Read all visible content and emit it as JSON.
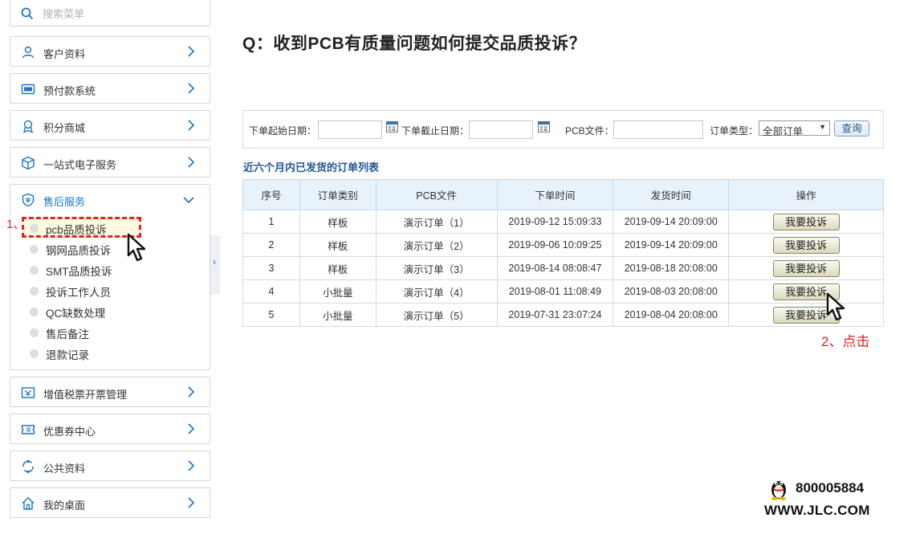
{
  "sidebar": {
    "search_placeholder": "搜索菜单",
    "items": [
      {
        "label": "客户资料"
      },
      {
        "label": "预付款系统"
      },
      {
        "label": "积分商城"
      },
      {
        "label": "一站式电子服务"
      }
    ],
    "expanded": {
      "label": "售后服务",
      "sub_items": [
        {
          "label": "pcb品质投诉"
        },
        {
          "label": "钢网品质投诉"
        },
        {
          "label": "SMT品质投诉"
        },
        {
          "label": "投诉工作人员"
        },
        {
          "label": "QC缺数处理"
        },
        {
          "label": "售后备注"
        },
        {
          "label": "退款记录"
        }
      ]
    },
    "items_after": [
      {
        "label": "增值税票开票管理"
      },
      {
        "label": "优惠券中心"
      },
      {
        "label": "公共资料"
      },
      {
        "label": "我的桌面"
      }
    ],
    "annotation": "1、"
  },
  "main": {
    "title": "Q：收到PCB有质量问题如何提交品质投诉？",
    "filter": {
      "start_date_label": "下单起始日期：",
      "end_date_label": "下单截止日期：",
      "pcb_file_label": "PCB文件：",
      "order_type_label": "订单类型：",
      "order_type_value": "全部订单",
      "query_button": "查询"
    },
    "list_title": "近六个月内已发货的订单列表",
    "table": {
      "headers": [
        "序号",
        "订单类别",
        "PCB文件",
        "下单时间",
        "发货时间",
        "操作"
      ],
      "rows": [
        {
          "no": "1",
          "type": "样板",
          "file": "演示订单（1）",
          "order_time": "2019-09-12 15:09:33",
          "ship_time": "2019-09-14 20:09:00",
          "action": "我要投诉"
        },
        {
          "no": "2",
          "type": "样板",
          "file": "演示订单（2）",
          "order_time": "2019-09-06 10:09:25",
          "ship_time": "2019-09-14 20:09:00",
          "action": "我要投诉"
        },
        {
          "no": "3",
          "type": "样板",
          "file": "演示订单（3）",
          "order_time": "2019-08-14 08:08:47",
          "ship_time": "2019-08-18 20:08:00",
          "action": "我要投诉"
        },
        {
          "no": "4",
          "type": "小批量",
          "file": "演示订单（4）",
          "order_time": "2019-08-01 11:08:49",
          "ship_time": "2019-08-03 20:08:00",
          "action": "我要投诉"
        },
        {
          "no": "5",
          "type": "小批量",
          "file": "演示订单（5）",
          "order_time": "2019-07-31 23:07:24",
          "ship_time": "2019-08-04 20:08:00",
          "action": "我要投诉"
        }
      ]
    },
    "annotation": "2、点击"
  },
  "brand": {
    "phone": "800005884",
    "site": "WWW.JLC.COM"
  },
  "colors": {
    "accent_blue": "#1a73c8",
    "annotation_red": "#e02424"
  }
}
